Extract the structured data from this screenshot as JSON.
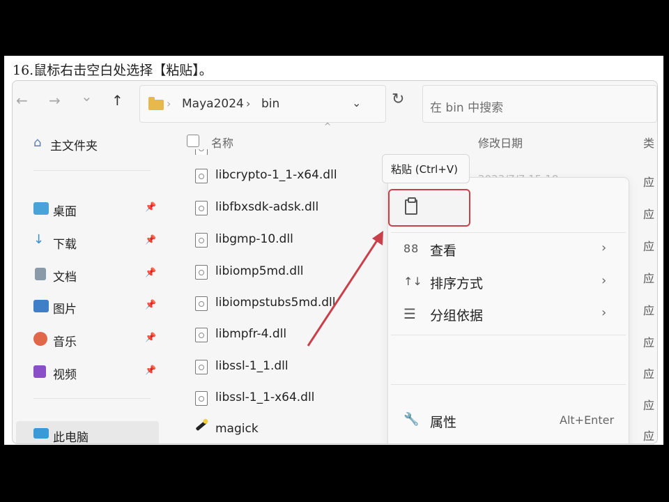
{
  "caption": "16.鼠标右击空白处选择【粘贴】。",
  "toolbar": {
    "back": "←",
    "forward": "→",
    "recent": "⌄",
    "up": "↑",
    "breadcrumb": [
      "Maya2024",
      "bin"
    ],
    "breadcrumb_sep": "›",
    "address_dropdown": "⌄",
    "refresh": "↻",
    "search_placeholder": "在 bin 中搜索"
  },
  "sidebar": {
    "home": "主文件夹",
    "items": [
      {
        "label": "桌面",
        "icon": "desktop-icon"
      },
      {
        "label": "下载",
        "icon": "download-icon"
      },
      {
        "label": "文档",
        "icon": "document-icon"
      },
      {
        "label": "图片",
        "icon": "pictures-icon"
      },
      {
        "label": "音乐",
        "icon": "music-icon"
      },
      {
        "label": "视频",
        "icon": "video-icon"
      }
    ],
    "pin": "📌",
    "this_pc": "此电脑"
  },
  "columns": {
    "name": "名称",
    "modified": "修改日期",
    "type": "类"
  },
  "files": [
    "libcrypto-1_1-x64.dll",
    "libfbxsdk-adsk.dll",
    "libgmp-10.dll",
    "libiomp5md.dll",
    "libiompstubs5md.dll",
    "libmpfr-4.dll",
    "libssl-1_1.dll",
    "libssl-1_1-x64.dll",
    "magick"
  ],
  "file_type_char": "应",
  "first_file_date": "2023/7/7 15:18",
  "context_menu": {
    "tooltip": "粘贴 (Ctrl+V)",
    "items": [
      {
        "label": "查看",
        "icon": "88",
        "chevron": "›"
      },
      {
        "label": "排序方式",
        "icon": "↑↓",
        "chevron": "›"
      },
      {
        "label": "分组依据",
        "icon": "☰",
        "chevron": "›"
      }
    ],
    "properties": {
      "label": "属性",
      "icon": "🔧",
      "shortcut": "Alt+Enter"
    }
  },
  "annotation_color": "#c8414a"
}
